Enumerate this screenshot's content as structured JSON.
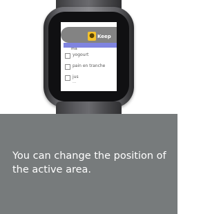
{
  "app": {
    "name": "Keep",
    "icon": "lightbulb-icon",
    "accent_color": "#f4c22b"
  },
  "list": {
    "partial_top_item": "ma",
    "items": [
      {
        "label": "yogourt",
        "checked": false
      },
      {
        "label": "pain en tranche",
        "checked": false
      },
      {
        "label": "jus",
        "checked": false
      }
    ],
    "partial_bottom_item": "..."
  },
  "caption": {
    "text": "You can change the position of the active area."
  },
  "colors": {
    "caption_background": "#777b7c",
    "highlight_bar": "#7f84e0"
  }
}
